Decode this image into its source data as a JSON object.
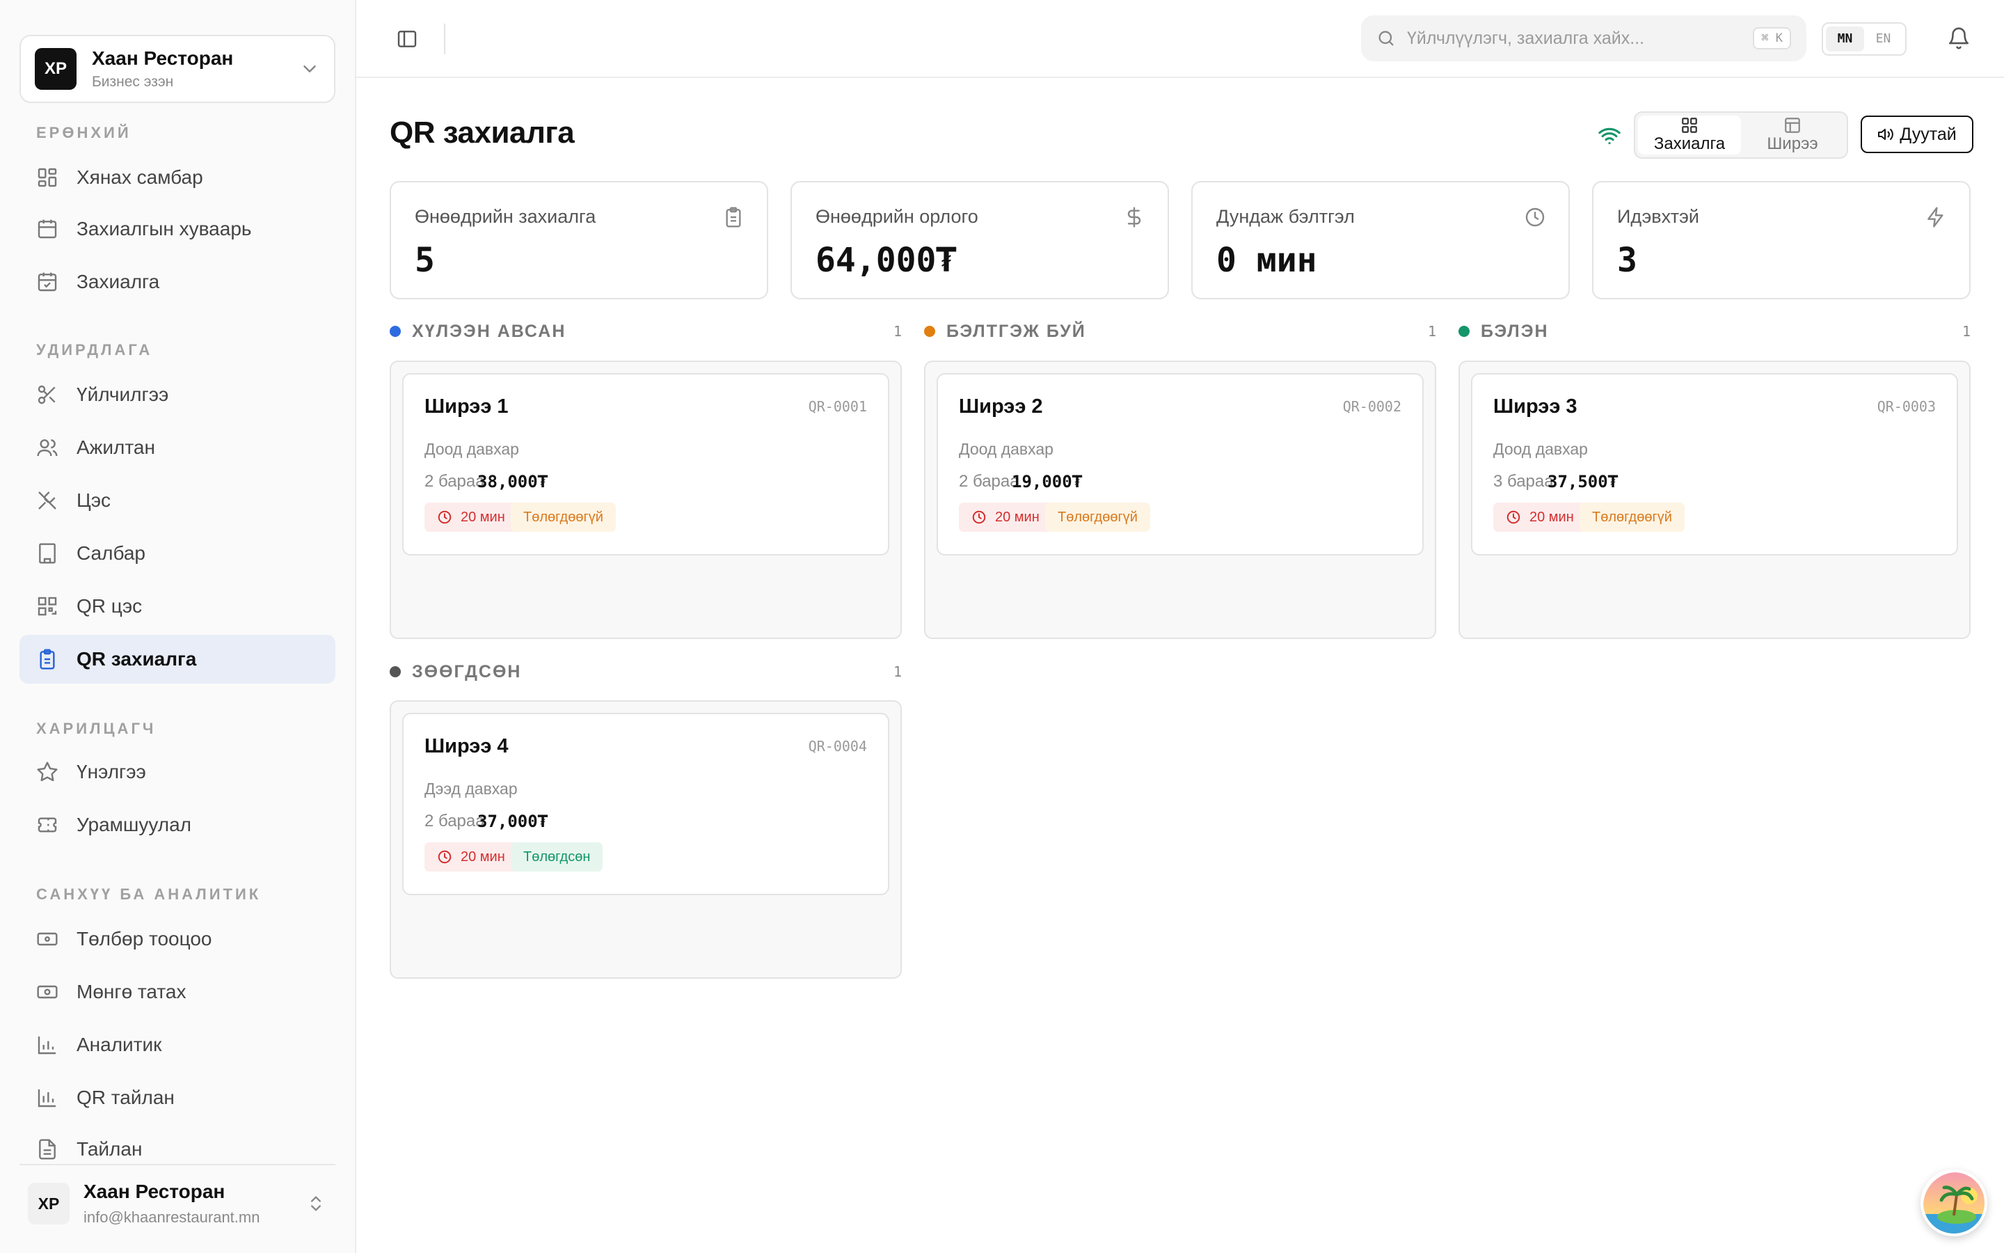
{
  "org": {
    "initials": "ХР",
    "name": "Хаан Ресторан",
    "role": "Бизнес эзэн"
  },
  "sidebar": {
    "sections": [
      {
        "label": "ЕРӨНХИЙ"
      },
      {
        "label": "УДИРДЛАГА"
      },
      {
        "label": "ХАРИЛЦАГЧ"
      },
      {
        "label": "САНХҮҮ БА АНАЛИТИК"
      }
    ],
    "items": [
      {
        "label": "Хянах самбар",
        "icon": "dashboard-icon"
      },
      {
        "label": "Захиалгын хуваарь",
        "icon": "calendar-icon"
      },
      {
        "label": "Захиалга",
        "icon": "calendar-check-icon"
      },
      {
        "label": "Үйлчилгээ",
        "icon": "scissors-icon"
      },
      {
        "label": "Ажилтан",
        "icon": "users-icon"
      },
      {
        "label": "Цэс",
        "icon": "utensils-icon"
      },
      {
        "label": "Салбар",
        "icon": "building-icon"
      },
      {
        "label": "QR цэс",
        "icon": "qr-code-icon"
      },
      {
        "label": "QR захиалга",
        "icon": "clipboard-icon",
        "active": true
      },
      {
        "label": "Үнэлгээ",
        "icon": "star-icon"
      },
      {
        "label": "Урамшуулал",
        "icon": "ticket-icon"
      },
      {
        "label": "Төлбөр тооцоо",
        "icon": "banknote-icon"
      },
      {
        "label": "Мөнгө татах",
        "icon": "wallet-icon"
      },
      {
        "label": "Аналитик",
        "icon": "bar-chart-icon"
      },
      {
        "label": "QR тайлан",
        "icon": "bar-chart-icon"
      },
      {
        "label": "Тайлан",
        "icon": "file-icon"
      }
    ],
    "footer": {
      "initials": "ХР",
      "name": "Хаан Ресторан",
      "email": "info@khaanrestaurant.mn"
    }
  },
  "topbar": {
    "search_placeholder": "Үйлчлүүлэгч, захиалга хайх...",
    "shortcut": "⌘ K",
    "lang": [
      "MN",
      "EN"
    ],
    "lang_active": "MN"
  },
  "page": {
    "title": "QR захиалга",
    "view_tabs": [
      "Захиалга",
      "Ширээ"
    ],
    "sound_button": "Дуутай",
    "colors": {
      "accent": "#2463d6",
      "received": "#2d6be0",
      "preparing": "#e07f12",
      "ready": "#14956a",
      "served": "#555555"
    }
  },
  "stats": [
    {
      "label": "Өнөөдрийн захиалга",
      "value": "5",
      "icon": "clipboard-icon"
    },
    {
      "label": "Өнөөдрийн орлого",
      "value": "64,000₮",
      "icon": "dollar-icon"
    },
    {
      "label": "Дундаж бэлтгэл",
      "value": "0 мин",
      "icon": "clock-icon"
    },
    {
      "label": "Идэвхтэй",
      "value": "3",
      "icon": "zap-icon"
    }
  ],
  "columns": [
    {
      "title": "ХҮЛЭЭН АВСАН",
      "count": "1",
      "orders": [
        {
          "table": "Ширээ 1",
          "code": "QR-0001",
          "floor": "Доод давхар",
          "items": "2 бараа",
          "total": "38,000₮",
          "time": "20 мин",
          "payment": "Төлөгдөөгүй"
        }
      ]
    },
    {
      "title": "БЭЛТГЭЖ БУЙ",
      "count": "1",
      "orders": [
        {
          "table": "Ширээ 2",
          "code": "QR-0002",
          "floor": "Доод давхар",
          "items": "2 бараа",
          "total": "19,000₮",
          "time": "20 мин",
          "payment": "Төлөгдөөгүй"
        }
      ]
    },
    {
      "title": "БЭЛЭН",
      "count": "1",
      "orders": [
        {
          "table": "Ширээ 3",
          "code": "QR-0003",
          "floor": "Доод давхар",
          "items": "3 бараа",
          "total": "37,500₮",
          "time": "20 мин",
          "payment": "Төлөгдөөгүй"
        }
      ]
    },
    {
      "title": "ЗӨӨГДСӨН",
      "count": "1",
      "orders": [
        {
          "table": "Ширээ 4",
          "code": "QR-0004",
          "floor": "Дээд давхар",
          "items": "2 бараа",
          "total": "37,000₮",
          "time": "20 мин",
          "payment": "Төлөгдсөн"
        }
      ]
    }
  ]
}
